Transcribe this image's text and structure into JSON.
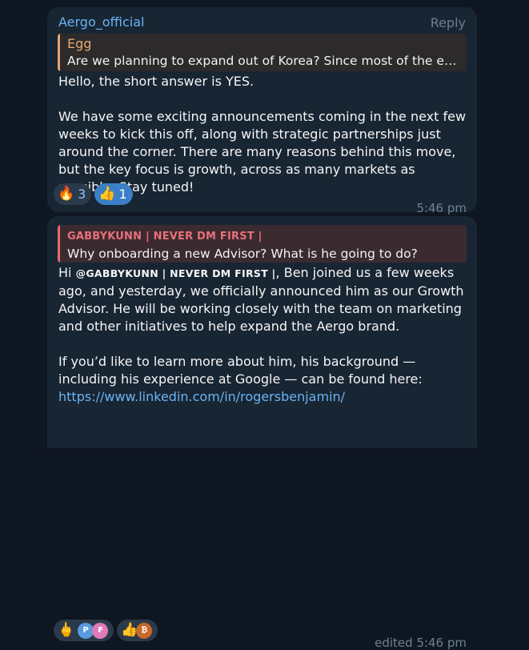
{
  "message1": {
    "sender": "Aergo_official",
    "reply_label": "Reply",
    "quote_author": "Egg",
    "quote_text": "Are we planning to expand out of Korea? Since most of the effo…",
    "line1": "Hello, the short answer is YES.",
    "paragraph": "We have some exciting announcements coming in the next few weeks to kick this off, along with strategic partnerships just around the corner. There are many reasons behind this move, but the key focus is growth, across as many markets as possible. Stay tuned!",
    "reactions": [
      {
        "emoji": "🔥",
        "count": "3"
      },
      {
        "emoji": "👍",
        "count": "1"
      }
    ],
    "time": "5:46 pm"
  },
  "message2": {
    "quote_author": "GABBYKUNN | NEVER DM FIRST |",
    "quote_text": "Why onboarding a new Advisor? What is he going to do?",
    "hi": "Hi ",
    "mention": "@GABBYKUNN | NEVER DM FIRST |",
    "rest": ", Ben joined us a few weeks ago, and yesterday, we officially announced him as our Growth Advisor. He will be working closely with the team on marketing and other initiatives to help expand the Aergo brand.",
    "paragraph2": "If you’d like to learn more about him, his background — including his experience at Google — can be found here:",
    "link": "https://www.linkedin.com/in/rogersbenjamin/",
    "reactions": [
      {
        "emoji": "🖕",
        "avatars": [
          "P",
          "₣"
        ]
      },
      {
        "emoji": "👍",
        "avatars": [
          "₿"
        ]
      }
    ],
    "time": "edited 5:46 pm"
  },
  "colors": {
    "background": "#0e1621",
    "bubble": "#182533",
    "sender": "#6ab3f3",
    "link": "#6ab3f3",
    "quote1_bar": "#e5a56f",
    "quote2_bar": "#e86b73"
  }
}
